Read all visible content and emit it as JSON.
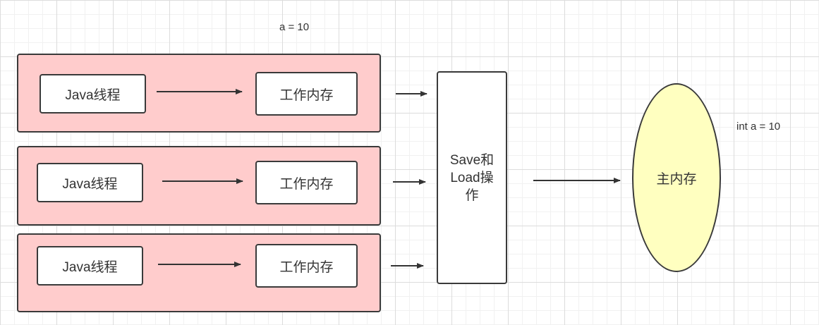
{
  "diagram": {
    "annotation_top": "a = 10",
    "annotation_right": "int a = 10",
    "threads": [
      {
        "thread_label": "Java线程",
        "memory_label": "工作内存"
      },
      {
        "thread_label": "Java线程",
        "memory_label": "工作内存"
      },
      {
        "thread_label": "Java线程",
        "memory_label": "工作内存"
      }
    ],
    "operation": {
      "line1": "Save和",
      "line2": "Load操",
      "line3": "作"
    },
    "main_memory_label": "主内存",
    "colors": {
      "thread_group_fill": "#ffcccc",
      "main_memory_fill": "#ffffc0",
      "stroke": "#3a3a3a"
    }
  }
}
